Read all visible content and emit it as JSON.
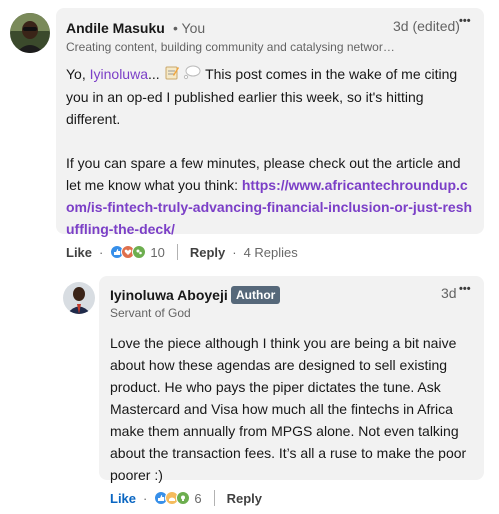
{
  "comment": {
    "author": "Andile Masuku",
    "relation": "• You",
    "headline": "Creating content, building community and catalysing networ…",
    "time": "3d (edited)",
    "more": "•••",
    "greeting": "Yo, ",
    "mention": "Iyinoluwa",
    "ellipsis": "... ",
    "text1": " This post comes in the wake of me citing you in an op-ed I published earlier this week, so it's hitting different.",
    "text2": "If you can spare a few minutes, please check out the article and let me know what you think: ",
    "link": "https://www.africantechroundup.com/is-fintech-truly-advancing-financial-inclusion-or-just-reshuffling-the-deck/",
    "like_label": "Like",
    "reaction_count": "10",
    "reply_label": "Reply",
    "replies_count": "4 Replies",
    "reaction_icons": [
      "like-reaction-icon",
      "love-reaction-icon",
      "celebrate-reaction-icon"
    ]
  },
  "reply": {
    "author": "Iyinoluwa Aboyeji",
    "badge": "Author",
    "headline": "Servant of God",
    "time": "3d",
    "more": "•••",
    "text": "Love the piece although I think you are being a bit naive about how these agendas are designed to sell existing product. He who pays the piper dictates the tune. Ask Mastercard and Visa how much all the fintechs in Africa make them annually from MPGS alone. Not even talking about the transaction fees. It’s all a ruse to make the poor poorer :)",
    "like_label": "Like",
    "reaction_count": "6",
    "reply_label": "Reply",
    "reaction_icons": [
      "like-reaction-icon",
      "support-reaction-icon",
      "insightful-reaction-icon"
    ]
  },
  "colors": {
    "mention": "#7b3fc7",
    "like_active": "#0a66c2",
    "bubble": "#f2f2f2",
    "badge": "#56687a"
  }
}
